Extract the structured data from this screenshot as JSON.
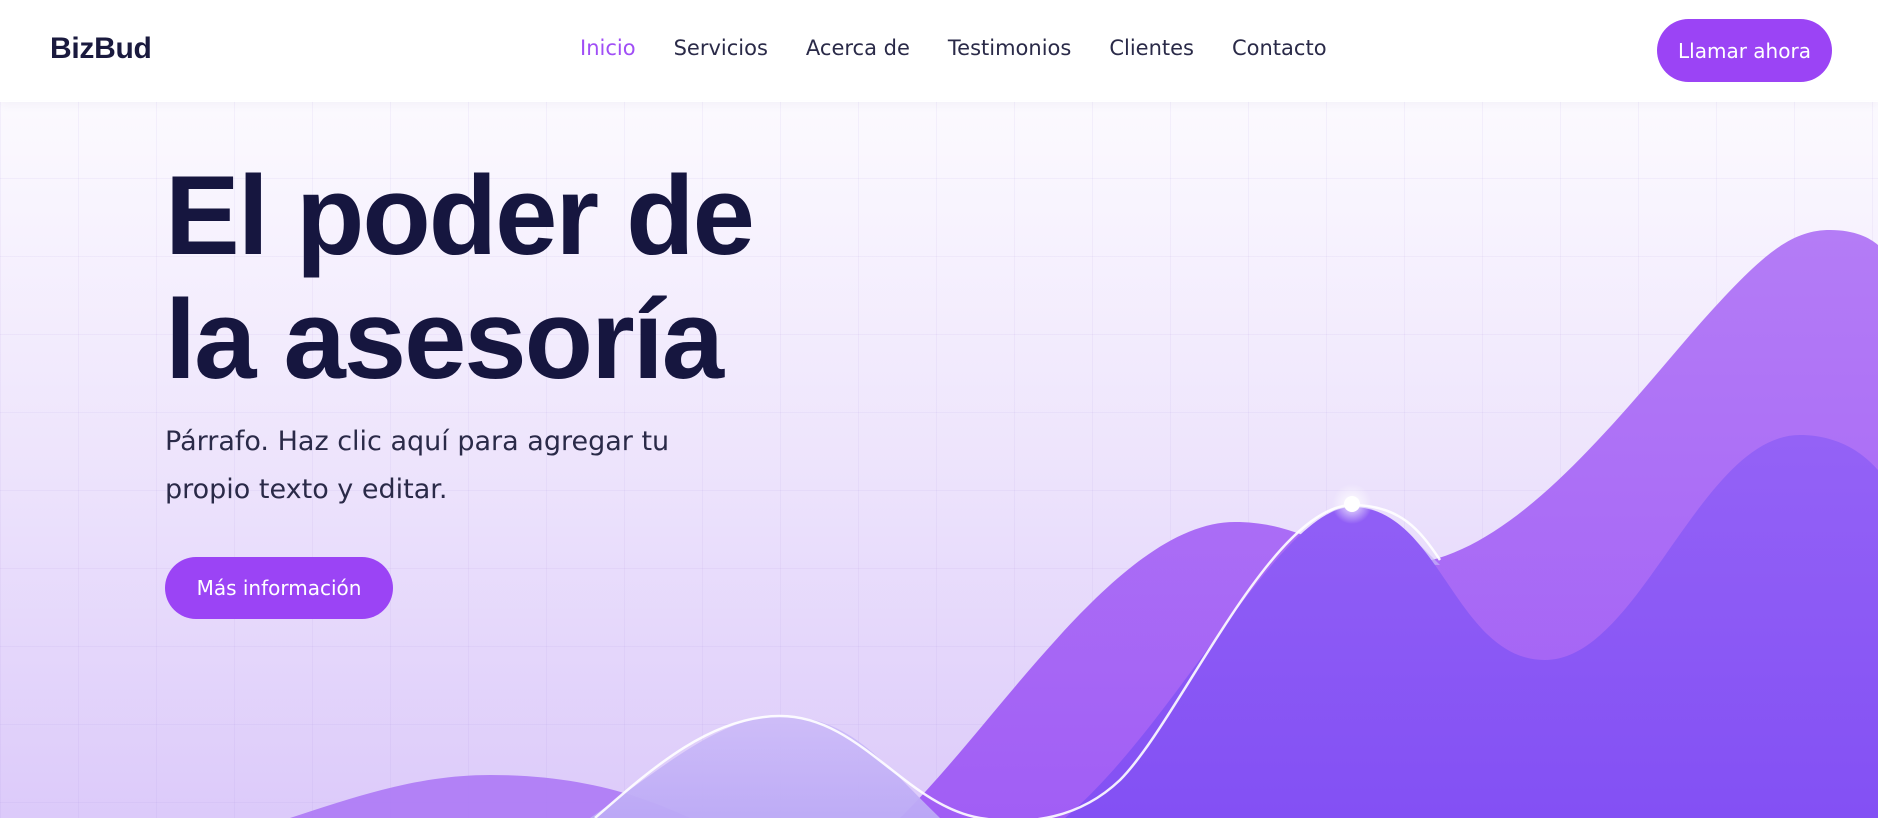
{
  "header": {
    "logo": "BizBud",
    "nav": [
      {
        "label": "Inicio",
        "active": true
      },
      {
        "label": "Servicios",
        "active": false
      },
      {
        "label": "Acerca de",
        "active": false
      },
      {
        "label": "Testimonios",
        "active": false
      },
      {
        "label": "Clientes",
        "active": false
      },
      {
        "label": "Contacto",
        "active": false
      }
    ],
    "cta_label": "Llamar ahora"
  },
  "hero": {
    "headline_line1": "El poder de",
    "headline_line2": "la asesoría",
    "paragraph_line1": "Párrafo. Haz clic aquí para agregar tu",
    "paragraph_line2": "propio texto y editar.",
    "button_label": "Más información"
  },
  "colors": {
    "accent": "#9b44f5",
    "nav_active": "#a04ef6",
    "headline": "#16163f",
    "text": "#2a2a48"
  }
}
